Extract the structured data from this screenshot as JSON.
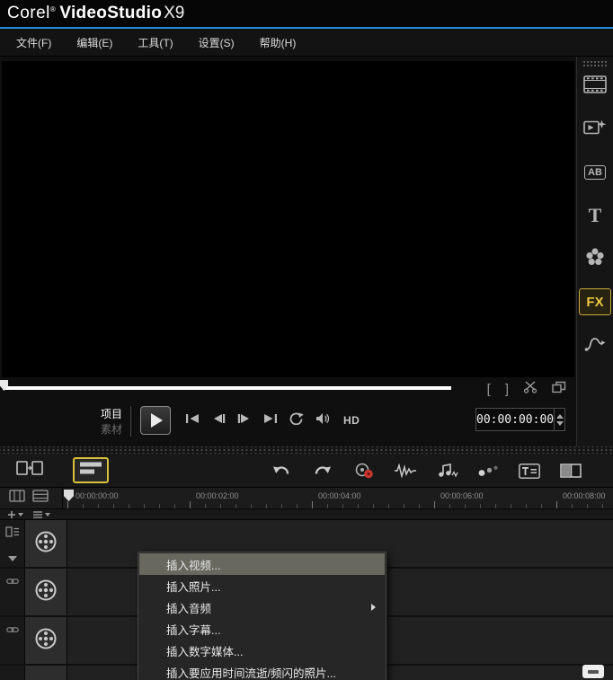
{
  "titlebar": {
    "brand": "Corel",
    "reg": "®",
    "product": "VideoStudio",
    "version": "X9"
  },
  "menubar": {
    "file": "文件(F)",
    "edit": "编辑(E)",
    "tools": "工具(T)",
    "settings": "设置(S)",
    "help": "帮助(H)"
  },
  "player": {
    "project_label": "项目",
    "clip_label": "素材",
    "hd_label": "HD",
    "timecode": "00:00:00:00",
    "mark_in": "[",
    "mark_out": "]"
  },
  "sidebar": {
    "transition_label": "AB",
    "title_label": "T",
    "filter_label": "FX",
    "active_item": "filter"
  },
  "timeline": {
    "ticks": [
      "00:00:00:00",
      "00:00:02:00",
      "00:00:04:00",
      "00:00:06:00",
      "00:00:08:00"
    ]
  },
  "context_menu": {
    "items": [
      "插入视频...",
      "插入照片...",
      "插入音频",
      "插入字幕...",
      "插入数字媒体...",
      "插入要应用时间流逝/频闪的照片..."
    ],
    "highlighted_index": 0,
    "submenu_index": 2
  },
  "colors": {
    "accent_blue": "#1d8fe0",
    "accent_yellow": "#d8c23a",
    "menu_highlight": "#68685f",
    "record_red": "#c8372f"
  }
}
